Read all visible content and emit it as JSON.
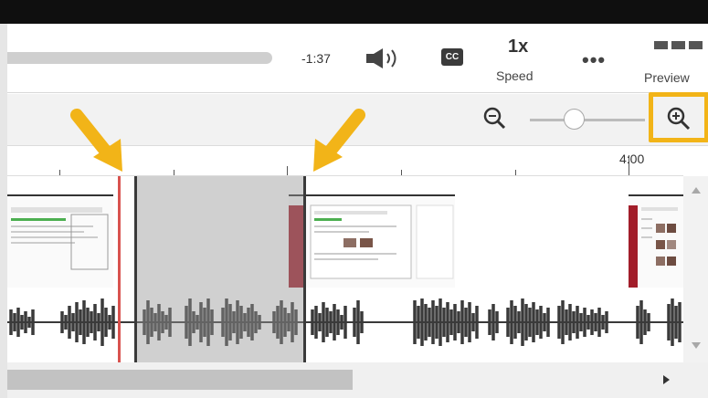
{
  "player": {
    "time_remaining": "-1:37",
    "cc_label": "CC",
    "speed_value": "1x",
    "speed_label": "Speed",
    "more_label": "•••",
    "preview_label": "Preview"
  },
  "timeline": {
    "ruler_label": "4:00"
  },
  "colors": {
    "accent_highlight": "#f2b418",
    "playhead": "#d9534f",
    "selection": "#a0a0a0"
  },
  "icons": [
    "volume-icon",
    "closed-captions-icon",
    "more-icon",
    "preview-icon",
    "zoom-out-icon",
    "zoom-in-icon",
    "callout-arrow-icon"
  ]
}
